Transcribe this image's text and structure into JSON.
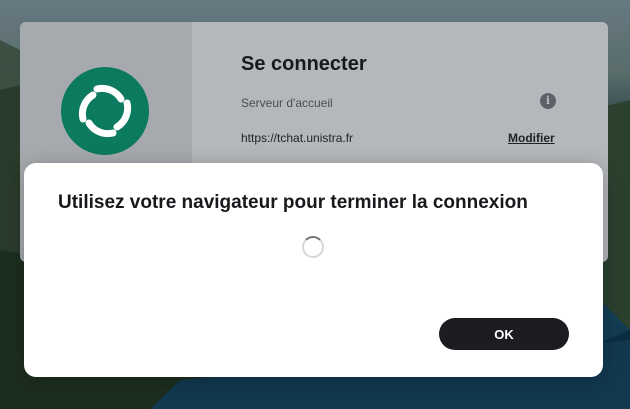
{
  "login": {
    "title": "Se connecter",
    "server_label": "Serveur d'accueil",
    "server_url": "https://tchat.unistra.fr",
    "modify_label": "Modifier",
    "info_glyph": "i"
  },
  "dialog": {
    "title": "Utilisez votre navigateur pour terminer la connexion",
    "ok_label": "OK"
  },
  "icons": {
    "logo": "element-logo-icon",
    "info": "info-icon",
    "spinner": "loading-spinner-icon"
  },
  "colors": {
    "brand": "#0b7a5f",
    "button_bg": "#1b1d22",
    "button_text": "#ffffff"
  }
}
